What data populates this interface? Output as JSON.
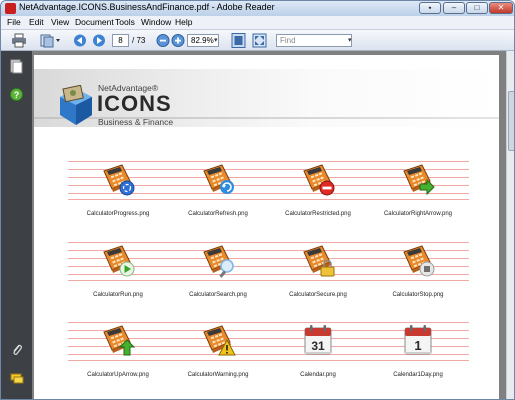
{
  "window": {
    "title": "NetAdvantage.ICONS.BusinessAndFinance.pdf - Adobe Reader",
    "controls": [
      "⬩",
      "–",
      "□",
      "✕"
    ]
  },
  "menu": [
    "File",
    "Edit",
    "View",
    "Document",
    "Tools",
    "Window",
    "Help"
  ],
  "toolbar": {
    "page_current": "8",
    "page_total": "/ 73",
    "zoom": "82.9%",
    "find_placeholder": "Find"
  },
  "doc_header": {
    "brand_small": "NetAdvantage®",
    "brand_big": "ICONS",
    "brand_sub": "Business & Finance"
  },
  "icons": [
    {
      "label": "CalculatorProgress.png",
      "badge": "progress",
      "badge_color": "#2f6fd6"
    },
    {
      "label": "CalculatorRefresh.png",
      "badge": "refresh",
      "badge_color": "#2f8be0"
    },
    {
      "label": "CalculatorRestricted.png",
      "badge": "restricted",
      "badge_color": "#e02b24"
    },
    {
      "label": "CalculatorRightArrow.png",
      "badge": "right-arrow",
      "badge_color": "#45b12f"
    },
    {
      "label": "CalculatorRun.png",
      "badge": "run",
      "badge_color": "#38a52a"
    },
    {
      "label": "CalculatorSearch.png",
      "badge": "search",
      "badge_color": "#7fb6e8"
    },
    {
      "label": "CalculatorSecure.png",
      "badge": "secure",
      "badge_color": "#f0c23a"
    },
    {
      "label": "CalculatorStop.png",
      "badge": "stop",
      "badge_color": "#6e6e6e"
    },
    {
      "label": "CalculatorUpArrow.png",
      "badge": "up-arrow",
      "badge_color": "#45b12f"
    },
    {
      "label": "CalculatorWarning.png",
      "badge": "warning",
      "badge_color": "#f2c21c"
    },
    {
      "label": "Calendar.png",
      "badge": "calendar-31",
      "badge_color": "#c73a32",
      "number": "31"
    },
    {
      "label": "Calendar1Day.png",
      "badge": "calendar-1",
      "badge_color": "#c73a32",
      "number": "1"
    }
  ]
}
